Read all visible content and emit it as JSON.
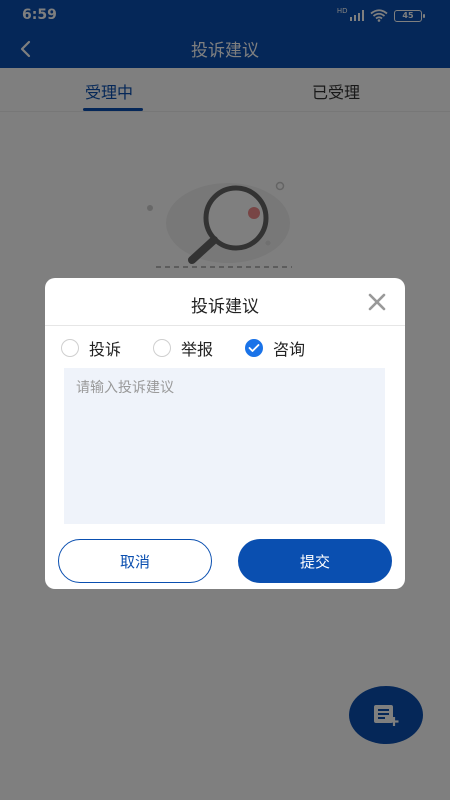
{
  "status_bar": {
    "time": "6:59",
    "network_label": "HD",
    "battery": "45"
  },
  "header": {
    "title": "投诉建议"
  },
  "tabs": [
    {
      "label": "受理中",
      "active": true
    },
    {
      "label": "已受理",
      "active": false
    }
  ],
  "dialog": {
    "title": "投诉建议",
    "options": [
      {
        "label": "投诉",
        "checked": false
      },
      {
        "label": "举报",
        "checked": false
      },
      {
        "label": "咨询",
        "checked": true
      }
    ],
    "input_placeholder": "请输入投诉建议",
    "input_value": "",
    "cancel_label": "取消",
    "submit_label": "提交"
  },
  "colors": {
    "primary": "#0a4fb0",
    "checked": "#1a73e8",
    "input_bg": "#eff3fa"
  }
}
